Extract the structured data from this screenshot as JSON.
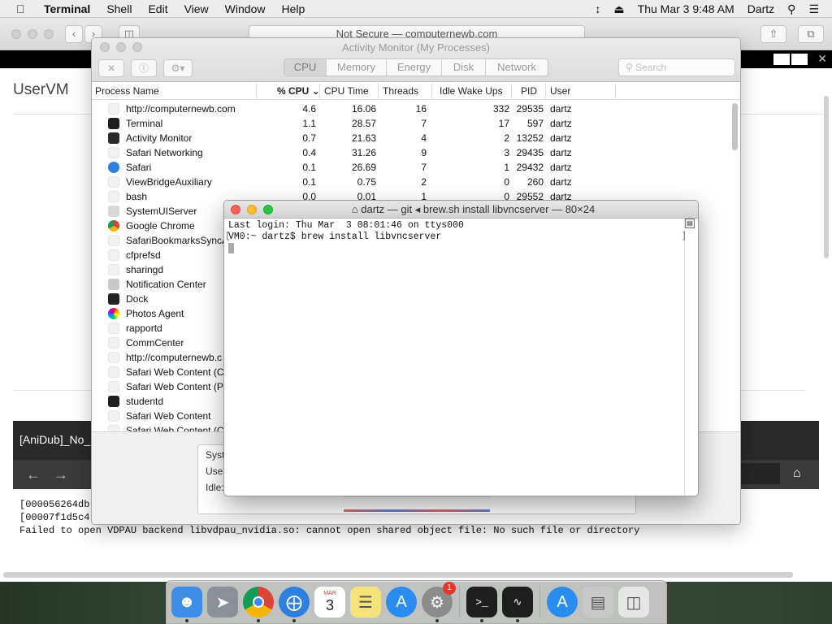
{
  "menubar": {
    "app_name": "Terminal",
    "items": [
      "Shell",
      "Edit",
      "View",
      "Window",
      "Help"
    ],
    "datetime": "Thu Mar 3  9:48 AM",
    "user": "Dartz"
  },
  "safari": {
    "address": "Not Secure — computernewb.com",
    "site_title": "UserVM",
    "video_title": "[AniDub]_No_",
    "output_lines": [
      "[000056264db",
      "[00007f1d5c4",
      "Failed to open VDPAU backend libvdpau_nvidia.so: cannot open shared object file: No such file or directory"
    ]
  },
  "activity_monitor": {
    "title": "Activity Monitor (My Processes)",
    "tabs": [
      {
        "label": "CPU",
        "active": true
      },
      {
        "label": "Memory",
        "active": false
      },
      {
        "label": "Energy",
        "active": false
      },
      {
        "label": "Disk",
        "active": false
      },
      {
        "label": "Network",
        "active": false
      }
    ],
    "search_placeholder": "Search",
    "columns": {
      "process_name": "Process Name",
      "cpu": "% CPU",
      "cpu_time": "CPU Time",
      "threads": "Threads",
      "idle_wake_ups": "Idle Wake Ups",
      "pid": "PID",
      "user": "User"
    },
    "rows": [
      {
        "name": "http://computernewb.com",
        "cpu": "4.6",
        "time": "16.06",
        "threads": "16",
        "idle": "332",
        "pid": "29535",
        "user": "dartz",
        "icon": "blank"
      },
      {
        "name": "Terminal",
        "cpu": "1.1",
        "time": "28.57",
        "threads": "7",
        "idle": "17",
        "pid": "597",
        "user": "dartz",
        "icon": "terminal"
      },
      {
        "name": "Activity Monitor",
        "cpu": "0.7",
        "time": "21.63",
        "threads": "4",
        "idle": "2",
        "pid": "13252",
        "user": "dartz",
        "icon": "monitor"
      },
      {
        "name": "Safari Networking",
        "cpu": "0.4",
        "time": "31.26",
        "threads": "9",
        "idle": "3",
        "pid": "29435",
        "user": "dartz",
        "icon": "blank"
      },
      {
        "name": "Safari",
        "cpu": "0.1",
        "time": "26.69",
        "threads": "7",
        "idle": "1",
        "pid": "29432",
        "user": "dartz",
        "icon": "safari"
      },
      {
        "name": "ViewBridgeAuxiliary",
        "cpu": "0.1",
        "time": "0.75",
        "threads": "2",
        "idle": "0",
        "pid": "260",
        "user": "dartz",
        "icon": "blank"
      },
      {
        "name": "bash",
        "cpu": "0.0",
        "time": "0.01",
        "threads": "1",
        "idle": "0",
        "pid": "29552",
        "user": "dartz",
        "icon": "blank"
      },
      {
        "name": "SystemUIServer",
        "cpu": "",
        "time": "",
        "threads": "",
        "idle": "",
        "pid": "",
        "user": "",
        "icon": "system"
      },
      {
        "name": "Google Chrome",
        "cpu": "",
        "time": "",
        "threads": "",
        "idle": "",
        "pid": "",
        "user": "",
        "icon": "chrome"
      },
      {
        "name": "SafariBookmarksSyncA",
        "cpu": "",
        "time": "",
        "threads": "",
        "idle": "",
        "pid": "",
        "user": "",
        "icon": "blank"
      },
      {
        "name": "cfprefsd",
        "cpu": "",
        "time": "",
        "threads": "",
        "idle": "",
        "pid": "",
        "user": "",
        "icon": "blank"
      },
      {
        "name": "sharingd",
        "cpu": "",
        "time": "",
        "threads": "",
        "idle": "",
        "pid": "",
        "user": "",
        "icon": "blank"
      },
      {
        "name": "Notification Center",
        "cpu": "",
        "time": "",
        "threads": "",
        "idle": "",
        "pid": "",
        "user": "",
        "icon": "notification"
      },
      {
        "name": "Dock",
        "cpu": "",
        "time": "",
        "threads": "",
        "idle": "",
        "pid": "",
        "user": "",
        "icon": "dock"
      },
      {
        "name": "Photos Agent",
        "cpu": "",
        "time": "",
        "threads": "",
        "idle": "",
        "pid": "",
        "user": "",
        "icon": "photos"
      },
      {
        "name": "rapportd",
        "cpu": "",
        "time": "",
        "threads": "",
        "idle": "",
        "pid": "",
        "user": "",
        "icon": "blank"
      },
      {
        "name": "CommCenter",
        "cpu": "",
        "time": "",
        "threads": "",
        "idle": "",
        "pid": "",
        "user": "",
        "icon": "blank"
      },
      {
        "name": "http://computernewb.c",
        "cpu": "",
        "time": "",
        "threads": "",
        "idle": "",
        "pid": "",
        "user": "",
        "icon": "blank"
      },
      {
        "name": "Safari Web Content (Ca",
        "cpu": "",
        "time": "",
        "threads": "",
        "idle": "",
        "pid": "",
        "user": "",
        "icon": "blank"
      },
      {
        "name": "Safari Web Content (Pre",
        "cpu": "",
        "time": "",
        "threads": "",
        "idle": "",
        "pid": "",
        "user": "",
        "icon": "blank"
      },
      {
        "name": "studentd",
        "cpu": "",
        "time": "",
        "threads": "",
        "idle": "",
        "pid": "",
        "user": "",
        "icon": "terminal"
      },
      {
        "name": "Safari Web Content",
        "cpu": "",
        "time": "",
        "threads": "",
        "idle": "",
        "pid": "",
        "user": "",
        "icon": "blank"
      },
      {
        "name": "Safari Web Content (Ca",
        "cpu": "",
        "time": "",
        "threads": "",
        "idle": "",
        "pid": "",
        "user": "",
        "icon": "blank"
      }
    ],
    "bottom_labels": [
      "Syst",
      "User",
      "Idle:"
    ]
  },
  "terminal": {
    "title": "dartz — git ◂ brew.sh install libvncserver — 80×24",
    "lines": [
      "Last login: Thu Mar  3 08:01:46 on ttys000",
      "VM0:~ dartz$ brew install libvncserver"
    ]
  },
  "dock": {
    "items": [
      {
        "name": "finder",
        "color": "#3d8ee6",
        "running": true
      },
      {
        "name": "launchpad",
        "color": "#8a8f98",
        "running": false
      },
      {
        "name": "chrome",
        "color": "#ffffff",
        "running": true
      },
      {
        "name": "safari",
        "color": "#2f7fe0",
        "running": true
      },
      {
        "name": "calendar",
        "color": "#ffffff",
        "running": false,
        "month": "MAR",
        "day": "3"
      },
      {
        "name": "notes",
        "color": "#f6e27a",
        "running": false
      },
      {
        "name": "app-store",
        "color": "#2b8cf0",
        "running": false
      },
      {
        "name": "system-preferences",
        "color": "#8c8c8c",
        "running": true,
        "badge": "1"
      },
      {
        "name": "terminal",
        "color": "#1e1e1e",
        "running": true
      },
      {
        "name": "activity-monitor",
        "color": "#1e1e1e",
        "running": true
      },
      {
        "name": "app-store-downloads",
        "color": "#2b8cf0",
        "running": false
      },
      {
        "name": "installer",
        "color": "#c9c9c9",
        "running": false
      },
      {
        "name": "trash",
        "color": "#e6e6e6",
        "running": false
      }
    ]
  }
}
